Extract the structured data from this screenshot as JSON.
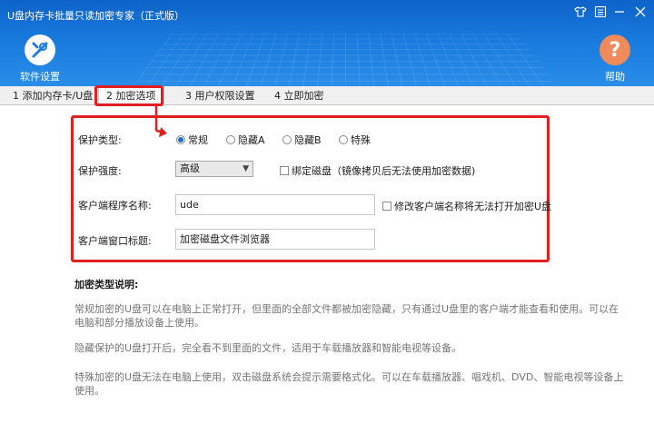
{
  "window": {
    "title": "U盘内存卡批量只读加密专家（正式版）"
  },
  "toolbar": {
    "settings_label": "软件设置",
    "help_label": "帮助"
  },
  "tabs": [
    {
      "label": "1 添加内存卡/U盘"
    },
    {
      "label": "2 加密选项"
    },
    {
      "label": "3 用户权限设置"
    },
    {
      "label": "4 立即加密"
    }
  ],
  "active_tab": 1,
  "protect_type": {
    "label": "保护类型:",
    "options": [
      "常规",
      "隐藏A",
      "隐藏B",
      "特殊"
    ],
    "selected": "常规"
  },
  "protect_strength": {
    "label": "保护强度:",
    "value": "高级"
  },
  "bind_disk": {
    "label": "绑定磁盘（镜像拷贝后无法使用加密数据)",
    "checked": false
  },
  "client_name": {
    "label": "客户端程序名称:",
    "value": "ude"
  },
  "modify_client": {
    "label": "修改客户端名称将无法打开加密U盘",
    "checked": false
  },
  "client_window_title": {
    "label": "客户端窗口标题:",
    "value": "加密磁盘文件浏览器"
  },
  "description": {
    "title": "加密类型说明:",
    "paragraphs": [
      "常规加密的U盘可以在电脑上正常打开，但里面的全部文件都被加密隐藏，只有通过U盘里的客户端才能查看和使用。可以在电脑和部分播放设备上使用。",
      "隐藏保护的U盘打开后，完全看不到里面的文件，适用于车载播放器和智能电视等设备。",
      "特殊加密的U盘无法在电脑上使用，双击磁盘系统会提示需要格式化。可以在车载播放器、唱戏机、DVD、智能电视等设备上使用。"
    ]
  },
  "colors": {
    "header_top": "#0d63c9",
    "header_bottom": "#2a8de8",
    "highlight": "#e02020",
    "help_icon": "#f08a5a"
  }
}
